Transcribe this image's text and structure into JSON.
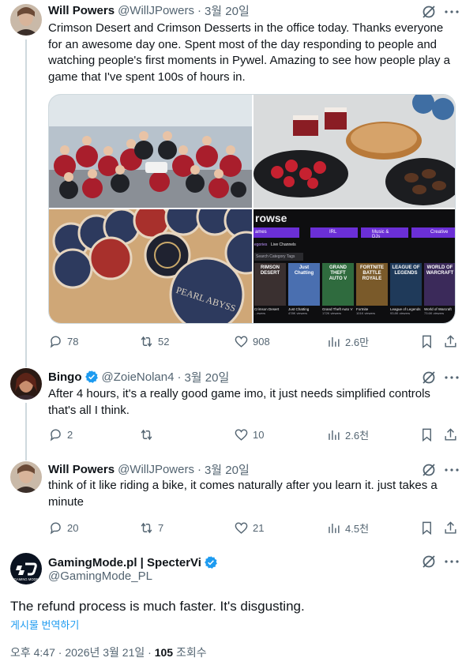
{
  "tweets": [
    {
      "name": "Will Powers",
      "handle": "@WillJPowers",
      "time": "3월 20일",
      "text": "Crimson Desert and Crimson Desserts in the office today. Thanks everyone for an awesome day one. Spent most of the day responding to people and watching people's first moments in Pywel. Amazing to see how people play a game that I've spent 100s of hours in.",
      "replies": "78",
      "reposts": "52",
      "likes": "908",
      "views": "2.6만",
      "media": {
        "twitch": {
          "browse": "rowse",
          "chips": [
            "ames",
            "IRL",
            "Music & DJs",
            "Creative"
          ],
          "tabs": [
            "egories",
            "Live Channels"
          ],
          "search": "Search Category Tags",
          "cards": [
            {
              "label": "RIMSON DESERT",
              "title": "Crimson Desert",
              "viewers": "...ewers"
            },
            {
              "label": "Just Chatting",
              "title": "Just Chatting",
              "viewers": "478K viewers"
            },
            {
              "label": "GRAND THEFT AUTO V",
              "title": "Grand Theft Auto V",
              "viewers": "172K viewers"
            },
            {
              "label": "FORTNITE BATTLE ROYALE",
              "title": "Fortnite",
              "viewers": "101K viewers"
            },
            {
              "label": "LEAGUE OF LEGENDS",
              "title": "League of Legends",
              "viewers": "93.8K viewers"
            },
            {
              "label": "WORLD OF WARCRAFT",
              "title": "World of Warcraft",
              "viewers": "73.6K viewers"
            }
          ]
        },
        "coaster_text": "PEARL ABYSS"
      }
    },
    {
      "name": "Bingo",
      "handle": "@ZoieNolan4",
      "time": "3월 20일",
      "text": "After 4 hours, it's a really good game imo, it just needs simplified controls that's all I think.",
      "replies": "2",
      "reposts": "",
      "likes": "10",
      "views": "2.6천"
    },
    {
      "name": "Will Powers",
      "handle": "@WillJPowers",
      "time": "3월 20일",
      "text": "think of it like riding a bike, it comes naturally after you learn it. just takes a minute",
      "replies": "20",
      "reposts": "7",
      "likes": "21",
      "views": "4.5천"
    }
  ],
  "main": {
    "name": "GamingMode.pl | SpecterVi",
    "handle": "@GamingMode_PL",
    "text": "The refund process is much faster. It's disgusting.",
    "translate": "게시물 번역하기",
    "timestamp": "오후 4:47 · 2026년 3월 21일 · ",
    "views_count": "105",
    "views_label": " 조회수",
    "avatar_text": "GAMING MODE"
  },
  "colors": {
    "text": "#0f1419",
    "secondary": "#536471",
    "verified": "#1d9bf0",
    "link": "#1d9bf0",
    "line": "#cfd9de"
  }
}
